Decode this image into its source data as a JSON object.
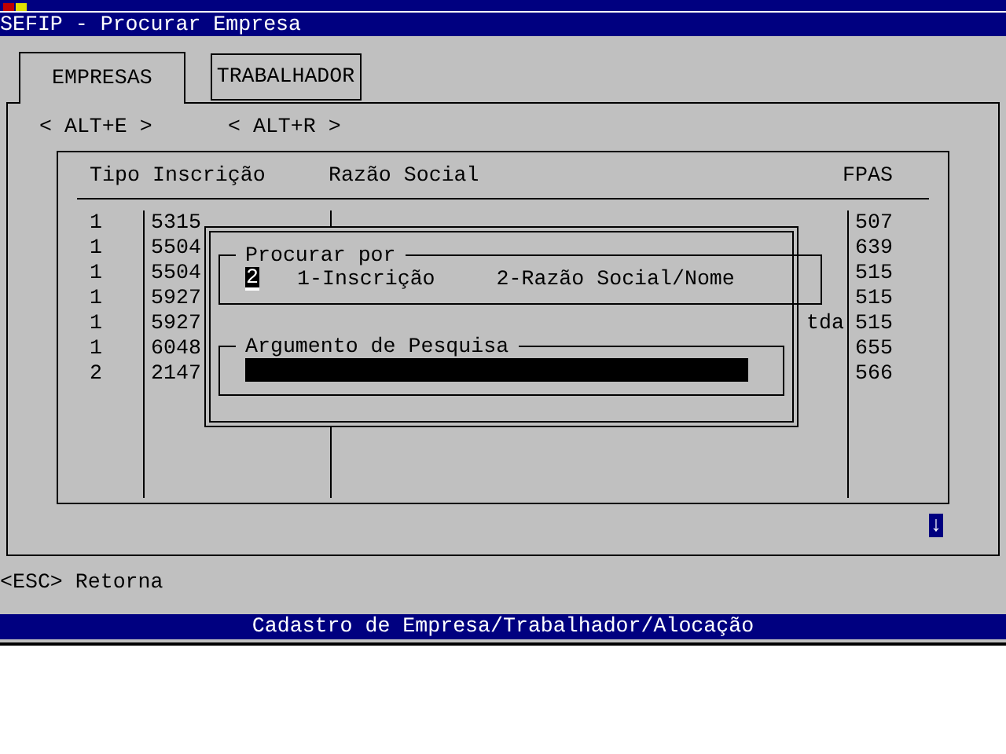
{
  "window": {
    "title": "SEFIP - Procurar Empresa"
  },
  "tabs": [
    {
      "label": "EMPRESAS",
      "selected": true
    },
    {
      "label": "TRABALHADOR",
      "selected": false
    }
  ],
  "shortcuts": [
    "< ALT+E >",
    "< ALT+R >"
  ],
  "table": {
    "columns": [
      "Tipo",
      "Inscrição",
      "Razão Social",
      "FPAS"
    ],
    "rows": [
      {
        "tipo": "1",
        "inscricao": "5315",
        "fpas": "507"
      },
      {
        "tipo": "1",
        "inscricao": "5504",
        "fpas": "639"
      },
      {
        "tipo": "1",
        "inscricao": "5504",
        "fpas": "515"
      },
      {
        "tipo": "1",
        "inscricao": "5927",
        "fpas": "515"
      },
      {
        "tipo": "1",
        "inscricao": "5927",
        "razao_social": "tda",
        "fpas": "515"
      },
      {
        "tipo": "1",
        "inscricao": "6048",
        "fpas": "655"
      },
      {
        "tipo": "2",
        "inscricao": "2147",
        "fpas": "566"
      }
    ]
  },
  "dialog": {
    "search_by": {
      "title": "Procurar por",
      "value": "2",
      "options": [
        "1-Inscrição",
        "2-Razão Social/Nome"
      ]
    },
    "argument": {
      "title": "Argumento de Pesquisa"
    }
  },
  "scroll_indicator": "↓",
  "hint": "<ESC> Retorna",
  "status_bar": "Cadastro de Empresa/Trabalhador/Alocação"
}
